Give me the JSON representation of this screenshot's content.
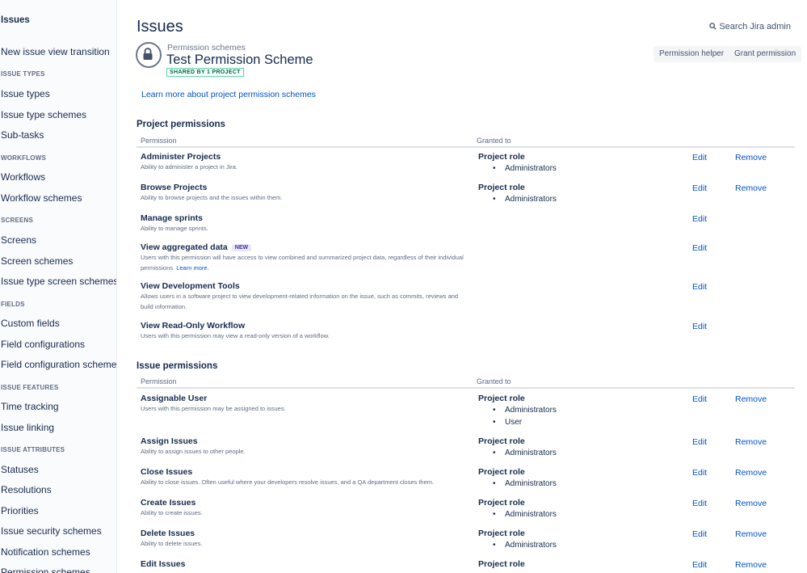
{
  "sidebar": {
    "title": "Issues",
    "items": [
      {
        "label": "New issue view transition"
      },
      {
        "head": "ISSUE TYPES"
      },
      {
        "label": "Issue types"
      },
      {
        "label": "Issue type schemes"
      },
      {
        "label": "Sub-tasks"
      },
      {
        "head": "WORKFLOWS"
      },
      {
        "label": "Workflows"
      },
      {
        "label": "Workflow schemes"
      },
      {
        "head": "SCREENS"
      },
      {
        "label": "Screens"
      },
      {
        "label": "Screen schemes"
      },
      {
        "label": "Issue type screen schemes"
      },
      {
        "head": "FIELDS"
      },
      {
        "label": "Custom fields"
      },
      {
        "label": "Field configurations"
      },
      {
        "label": "Field configuration schemes"
      },
      {
        "head": "ISSUE FEATURES"
      },
      {
        "label": "Time tracking"
      },
      {
        "label": "Issue linking"
      },
      {
        "head": "ISSUE ATTRIBUTES"
      },
      {
        "label": "Statuses"
      },
      {
        "label": "Resolutions"
      },
      {
        "label": "Priorities"
      },
      {
        "label": "Issue security schemes"
      },
      {
        "label": "Notification schemes"
      },
      {
        "label": "Permission schemes"
      }
    ]
  },
  "header": {
    "title": "Issues",
    "search_label": "Search Jira admin",
    "breadcrumb": "Permission schemes",
    "scheme_name": "Test Permission Scheme",
    "shared_badge": "SHARED BY 1 PROJECT",
    "permission_helper": "Permission helper",
    "grant_permission": "Grant permission",
    "learn_more": "Learn more about project permission schemes"
  },
  "columns": {
    "permission": "Permission",
    "granted_to": "Granted to"
  },
  "actions": {
    "edit": "Edit",
    "remove": "Remove"
  },
  "project_permissions": {
    "title": "Project permissions",
    "rows": [
      {
        "name": "Administer Projects",
        "desc": "Ability to administer a project in Jira.",
        "role": "Project role",
        "grantees": [
          "Administrators"
        ],
        "removable": true
      },
      {
        "name": "Browse Projects",
        "desc": "Ability to browse projects and the issues within them.",
        "role": "Project role",
        "grantees": [
          "Administrators"
        ],
        "removable": true
      },
      {
        "name": "Manage sprints",
        "desc": "Ability to manage sprints.",
        "role": "",
        "grantees": [],
        "removable": false
      },
      {
        "name": "View aggregated data",
        "badge": "NEW",
        "desc": "Users with this permission will have access to view combined and summarized project data, regardless of their individual permissions.",
        "link": "Learn more.",
        "role": "",
        "grantees": [],
        "removable": false
      },
      {
        "name": "View Development Tools",
        "desc": "Allows users in a software project to view development-related information on the issue, such as commits, reviews and build information.",
        "role": "",
        "grantees": [],
        "removable": false
      },
      {
        "name": "View Read-Only Workflow",
        "desc": "Users with this permission may view a read-only version of a workflow.",
        "role": "",
        "grantees": [],
        "removable": false
      }
    ]
  },
  "issue_permissions": {
    "title": "Issue permissions",
    "rows": [
      {
        "name": "Assignable User",
        "desc": "Users with this permission may be assigned to issues.",
        "role": "Project role",
        "grantees": [
          "Administrators",
          "User"
        ],
        "removable": true
      },
      {
        "name": "Assign Issues",
        "desc": "Ability to assign issues to other people.",
        "role": "Project role",
        "grantees": [
          "Administrators"
        ],
        "removable": true
      },
      {
        "name": "Close Issues",
        "desc": "Ability to close issues. Often useful where your developers resolve issues, and a QA department closes them.",
        "role": "Project role",
        "grantees": [
          "Administrators"
        ],
        "removable": true
      },
      {
        "name": "Create Issues",
        "desc": "Ability to create issues.",
        "role": "Project role",
        "grantees": [
          "Administrators"
        ],
        "removable": true
      },
      {
        "name": "Delete Issues",
        "desc": "Ability to delete issues.",
        "role": "Project role",
        "grantees": [
          "Administrators"
        ],
        "removable": true
      },
      {
        "name": "Edit Issues",
        "desc": "",
        "role": "Project role",
        "grantees": [],
        "removable": true
      }
    ]
  }
}
